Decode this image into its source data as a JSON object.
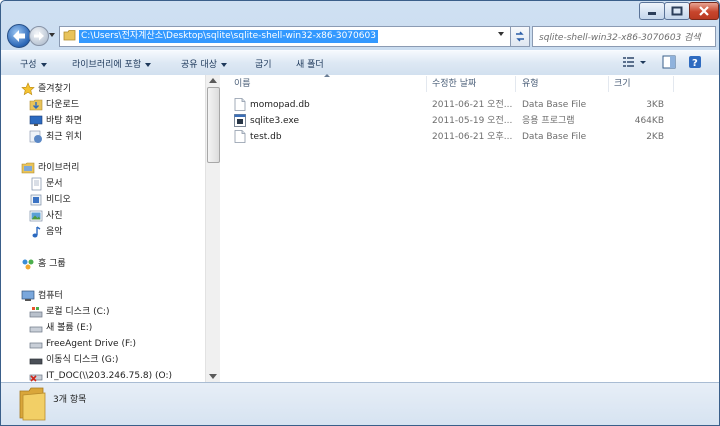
{
  "address": {
    "path": "C:\\Users\\전자계산소\\Desktop\\sqlite\\sqlite-shell-win32-x86-3070603",
    "search_placeholder": "sqlite-shell-win32-x86-3070603 검색"
  },
  "toolbar": {
    "organize": "구성",
    "include_in_library": "라이브러리에 포함",
    "share_with": "공유 대상",
    "burn": "굽기",
    "new_folder": "새 폴더"
  },
  "nav": {
    "favorites": "즐겨찾기",
    "downloads": "다운로드",
    "desktop": "바탕 화면",
    "recent": "최근 위치",
    "libraries": "라이브러리",
    "documents": "문서",
    "videos": "비디오",
    "pictures": "사진",
    "music": "음악",
    "homegroup": "홈 그룹",
    "computer": "컴퓨터",
    "local_disk": "로컬 디스크 (C:)",
    "new_volume": "새 볼륨 (E:)",
    "freeagent": "FreeAgent Drive (F:)",
    "removable": "이동식 디스크 (G:)",
    "it_doc": "IT_DOC(\\\\203.246.75.8) (O:)"
  },
  "columns": {
    "name": "이름",
    "modified": "수정한 날짜",
    "type": "유형",
    "size": "크기"
  },
  "files": [
    {
      "name": "momopad.db",
      "modified": "2011-06-21 오전...",
      "type": "Data Base File",
      "size": "3KB",
      "icon": "db-file-icon"
    },
    {
      "name": "sqlite3.exe",
      "modified": "2011-05-19 오전...",
      "type": "응용 프로그램",
      "size": "464KB",
      "icon": "exe-file-icon"
    },
    {
      "name": "test.db",
      "modified": "2011-06-21 오후...",
      "type": "Data Base File",
      "size": "2KB",
      "icon": "db-file-icon"
    }
  ],
  "status": {
    "item_count": "3개 항목"
  }
}
